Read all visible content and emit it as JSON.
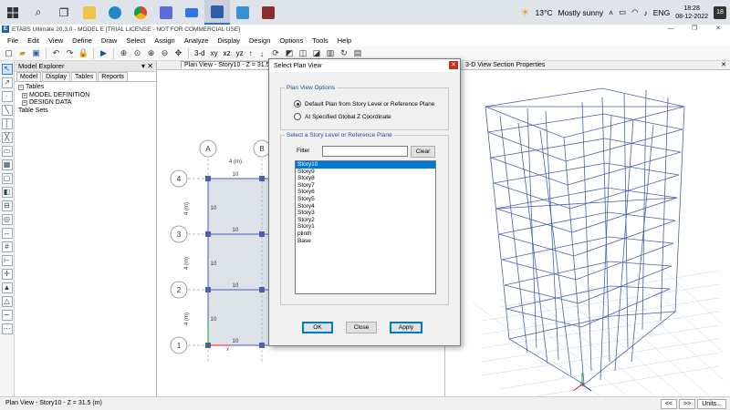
{
  "taskbar": {
    "search_icon": "search-icon",
    "weather": {
      "temp": "13°C",
      "condition": "Mostly sunny"
    },
    "lang": "ENG",
    "time": "18:28",
    "date": "08-12-2022",
    "notifications": "18"
  },
  "window": {
    "title": "ETABS Ultimate 20.3.0 - MODEL E  [TRIAL LICENSE - NOT FOR COMMERCIAL USE]",
    "icon_letter": "E"
  },
  "menu": [
    "File",
    "Edit",
    "View",
    "Define",
    "Draw",
    "Select",
    "Assign",
    "Analyze",
    "Display",
    "Design",
    "Options",
    "Tools",
    "Help"
  ],
  "toolbar": {
    "view_3d": "3-d",
    "view_plan": "xy",
    "view_elev_xz": "xz",
    "view_elev_yz": "yz",
    "nav_up": "↑"
  },
  "explorer": {
    "title": "Model Explorer",
    "tabs": [
      "Model",
      "Display",
      "Tables",
      "Reports"
    ],
    "tree": {
      "root": "Tables",
      "children": [
        "MODEL DEFINITION",
        "DESIGN DATA"
      ],
      "sibling": "Table Sets"
    }
  },
  "plan": {
    "tab": "Plan View - Story10 - Z = 31.5 (m)",
    "col_bubbles": [
      "A",
      "B"
    ],
    "row_bubbles": [
      "4",
      "3",
      "2",
      "1"
    ],
    "span_label": "4 (m)",
    "beam_label": "10"
  },
  "view3d": {
    "tab": "3-D View  Section Properties",
    "close": "✕"
  },
  "dialog": {
    "title": "Select Plan View",
    "group1": "Plan View Options",
    "opt1": "Default Plan from Story Level or Reference Plane",
    "opt2": "At Specified Global Z Coordinate",
    "group2": "Select a Story Level or Reference Plane",
    "filter_label": "Filter",
    "filter_value": "",
    "clear": "Clear",
    "stories": [
      "Story10",
      "Story9",
      "Story8",
      "Story7",
      "Story6",
      "Story5",
      "Story4",
      "Story3",
      "Story2",
      "Story1",
      "plinth",
      "Base"
    ],
    "selected": "Story10",
    "ok": "OK",
    "close": "Close",
    "apply": "Apply"
  },
  "status": {
    "text": "Plan View - Story10 - Z = 31.5 (m)",
    "units": "Units...",
    "prev": "<<",
    "next": ">>"
  },
  "colors": {
    "accent": "#0078d7",
    "frame": "#4a5fb0",
    "grid": "#9fb5d0"
  }
}
